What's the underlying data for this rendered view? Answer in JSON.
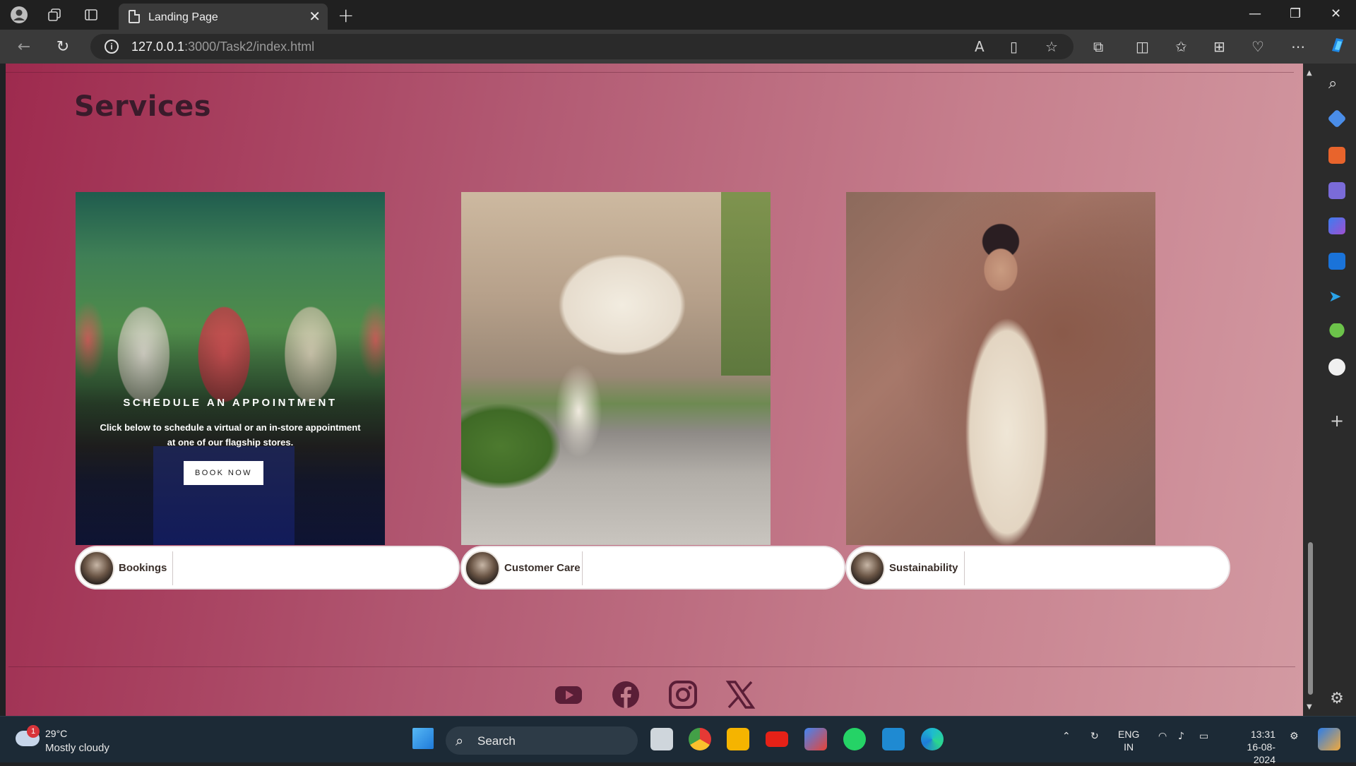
{
  "browser": {
    "tab_title": "Landing Page",
    "url_host": "127.0.0.1",
    "url_rest": ":3000/Task2/index.html"
  },
  "page": {
    "section_title": "Services",
    "appointment": {
      "title": "SCHEDULE AN APPOINTMENT",
      "text": "Click below to schedule a virtual or an in-store appointment at one of our flagship stores.",
      "button_label": "BOOK NOW"
    },
    "cards": [
      {
        "label": "Bookings"
      },
      {
        "label": "Customer Care"
      },
      {
        "label": "Sustainability"
      }
    ],
    "social": [
      "youtube-icon",
      "facebook-icon",
      "instagram-icon",
      "x-icon"
    ],
    "colors": {
      "bg_start": "#9e2a4e",
      "bg_end": "#d39aa2",
      "title": "#3a1b2b"
    }
  },
  "taskbar": {
    "weather_temp": "29°C",
    "weather_desc": "Mostly cloudy",
    "weather_badge": "1",
    "search_label": "Search",
    "lang_top": "ENG",
    "lang_bottom": "IN",
    "time": "13:31",
    "date": "16-08-2024"
  }
}
